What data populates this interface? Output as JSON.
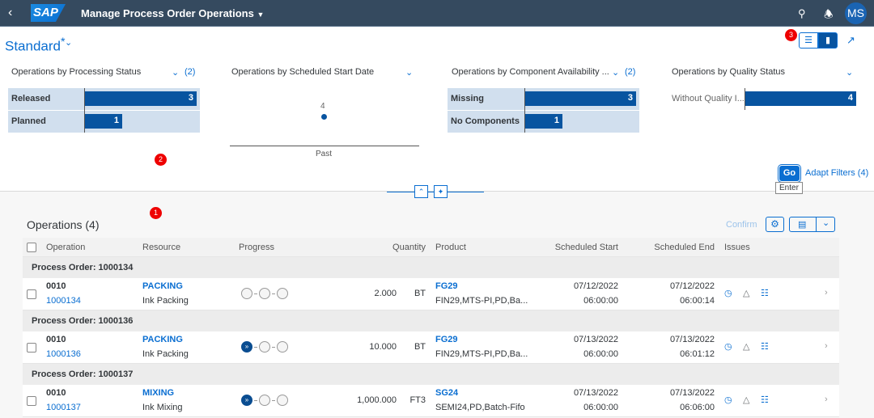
{
  "shell": {
    "title": "Manage Process Order Operations",
    "logo": "SAP",
    "avatar": "MS"
  },
  "header": {
    "variant": "Standard",
    "variant_modified": "*",
    "badges": [
      "1",
      "2",
      "3"
    ]
  },
  "charts": [
    {
      "title": "Operations by Processing Status",
      "count": "(2)",
      "bars": [
        {
          "label": "Released",
          "value": 3
        },
        {
          "label": "Planned",
          "value": 1
        }
      ]
    },
    {
      "title": "Operations by Scheduled Start Date",
      "points": [
        {
          "label": "Past",
          "value": 4
        }
      ]
    },
    {
      "title": "Operations by Component Availability ...",
      "count": "(2)",
      "bars": [
        {
          "label": "Missing",
          "value": 3
        },
        {
          "label": "No Components",
          "value": 1
        }
      ]
    },
    {
      "title": "Operations by Quality Status",
      "bars": [
        {
          "label": "Without Quality I...",
          "value": 4
        }
      ]
    }
  ],
  "filterbar": {
    "go": "Go",
    "adapt": "Adapt Filters (4)",
    "tooltip": "Enter"
  },
  "table": {
    "title": "Operations (4)",
    "confirm": "Confirm",
    "columns": [
      "Operation",
      "Resource",
      "Progress",
      "Quantity",
      "Product",
      "Scheduled Start",
      "Scheduled End",
      "Issues"
    ],
    "groups": [
      {
        "header": "Process Order: 1000134",
        "op": "0010",
        "order": "1000134",
        "resource": "PACKING",
        "resource_desc": "Ink Packing",
        "progress_started": false,
        "qty": "2.000",
        "unit": "BT",
        "product": "FG29",
        "product_desc": "FIN29,MTS-PI,PD,Ba...",
        "start_date": "07/12/2022",
        "start_time": "06:00:00",
        "end_date": "07/12/2022",
        "end_time": "06:00:14"
      },
      {
        "header": "Process Order: 1000136",
        "op": "0010",
        "order": "1000136",
        "resource": "PACKING",
        "resource_desc": "Ink Packing",
        "progress_started": true,
        "qty": "10.000",
        "unit": "BT",
        "product": "FG29",
        "product_desc": "FIN29,MTS-PI,PD,Ba...",
        "start_date": "07/13/2022",
        "start_time": "06:00:00",
        "end_date": "07/13/2022",
        "end_time": "06:01:12"
      },
      {
        "header": "Process Order: 1000137",
        "op": "0010",
        "order": "1000137",
        "resource": "MIXING",
        "resource_desc": "Ink Mixing",
        "progress_started": true,
        "qty": "1,000.000",
        "unit": "FT3",
        "product": "SG24",
        "product_desc": "SEMI24,PD,Batch-Fifo",
        "start_date": "07/13/2022",
        "start_time": "06:00:00",
        "end_date": "07/13/2022",
        "end_time": "06:06:00"
      }
    ]
  }
}
